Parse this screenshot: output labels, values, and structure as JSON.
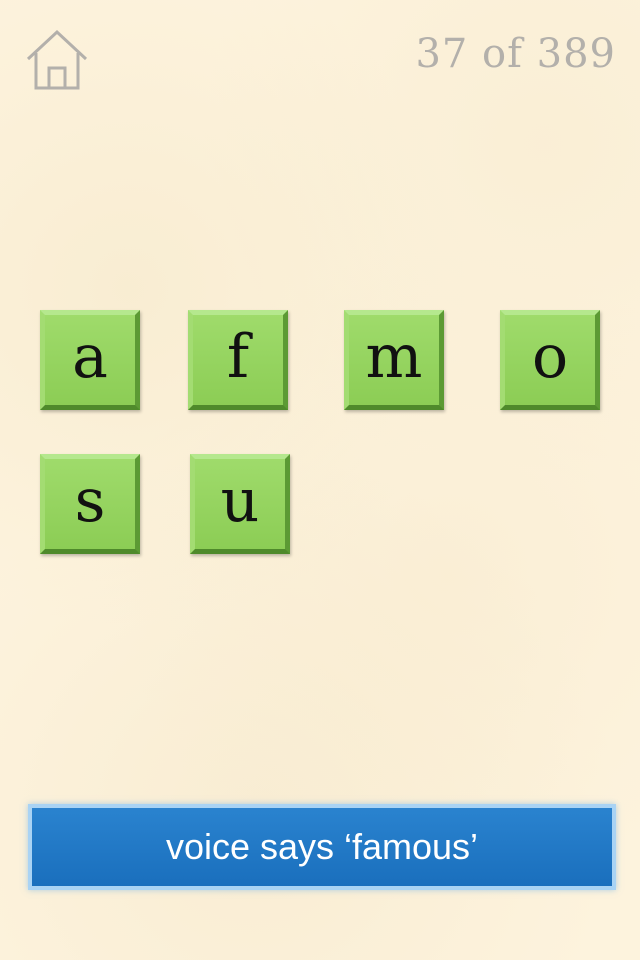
{
  "header": {
    "home_icon": "home-icon",
    "progress_text": "37 of 389"
  },
  "tiles": [
    {
      "letter": "a"
    },
    {
      "letter": "f"
    },
    {
      "letter": "m"
    },
    {
      "letter": "o"
    },
    {
      "letter": "s"
    },
    {
      "letter": "u"
    }
  ],
  "voice_button": {
    "label": "voice says ‘famous’"
  },
  "colors": {
    "background": "#fdf3dd",
    "tile_green": "#93d35f",
    "button_blue": "#1f78c6",
    "progress_gray": "#b3b0ab"
  }
}
